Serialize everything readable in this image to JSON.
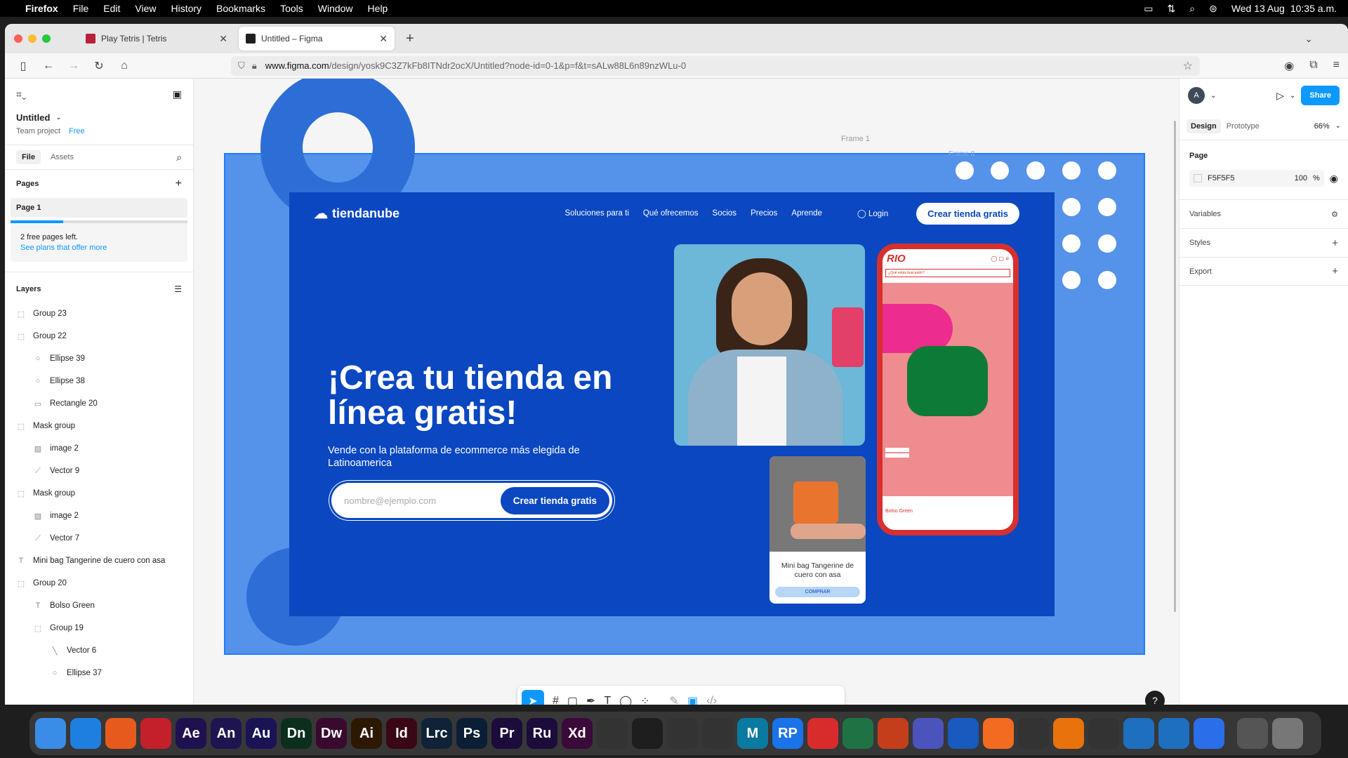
{
  "menubar": {
    "items": [
      "Firefox",
      "File",
      "Edit",
      "View",
      "History",
      "Bookmarks",
      "Tools",
      "Window",
      "Help"
    ],
    "date": "Wed 13 Aug",
    "time": "10:35 a.m."
  },
  "browser": {
    "tabs": [
      {
        "title": "Play Tetris | Tetris",
        "fav_color": "#b9203a"
      },
      {
        "title": "Untitled – Figma",
        "fav_color": "#1e1e1e"
      }
    ],
    "url_host": "www.figma.com",
    "url_path": "/design/yosk9C3Z7kFb8ITNdr2ocX/Untitled?node-id=0-1&p=f&t=sALw88L6n89nzWLu-0"
  },
  "left_panel": {
    "file_name": "Untitled",
    "project": "Team project",
    "plan": "Free",
    "tabs": [
      "File",
      "Assets"
    ],
    "pages_heading": "Pages",
    "page": "Page 1",
    "notice": "2 free pages left.",
    "notice_link": "See plans that offer more",
    "layers_heading": "Layers",
    "layers": [
      {
        "name": "Group 23",
        "indent": 0,
        "icon": "group"
      },
      {
        "name": "Group 22",
        "indent": 0,
        "icon": "group"
      },
      {
        "name": "Ellipse 39",
        "indent": 1,
        "icon": "ellipse"
      },
      {
        "name": "Ellipse 38",
        "indent": 1,
        "icon": "ellipse"
      },
      {
        "name": "Rectangle 20",
        "indent": 1,
        "icon": "rect"
      },
      {
        "name": "Mask group",
        "indent": 0,
        "icon": "group"
      },
      {
        "name": "image 2",
        "indent": 1,
        "icon": "image"
      },
      {
        "name": "Vector 9",
        "indent": 1,
        "icon": "vector"
      },
      {
        "name": "Mask group",
        "indent": 0,
        "icon": "group"
      },
      {
        "name": "image 2",
        "indent": 1,
        "icon": "image"
      },
      {
        "name": "Vector 7",
        "indent": 1,
        "icon": "vector"
      },
      {
        "name": "Mini bag Tangerine de cuero con asa",
        "indent": 0,
        "icon": "text"
      },
      {
        "name": "Group 20",
        "indent": 0,
        "icon": "group"
      },
      {
        "name": "Bolso Green",
        "indent": 1,
        "icon": "text"
      },
      {
        "name": "Group 19",
        "indent": 1,
        "icon": "group"
      },
      {
        "name": "Vector 6",
        "indent": 2,
        "icon": "line"
      },
      {
        "name": "Ellipse 37",
        "indent": 2,
        "icon": "ellipse"
      }
    ]
  },
  "canvas": {
    "frame_label": "Frame 1",
    "frame_label_2": "Frame 8",
    "site": {
      "logo": "tiendanube",
      "nav": [
        "Soluciones para ti",
        "Qué ofrecemos",
        "Socios",
        "Precios",
        "Aprende"
      ],
      "login": "Login",
      "cta": "Crear tienda gratis",
      "headline": "¡Crea tu tienda en línea gratis!",
      "subheadline": "Vende con la plataforma de ecommerce más elegida de Latinoamerica",
      "email_placeholder": "nombre@ejemplo.com",
      "form_button": "Crear tienda gratis",
      "phone_brand": "RIO",
      "phone_search": "¿Qué estás buscando?",
      "phone_product": "Bolso Green",
      "card_title": "Mini bag Tangerine de cuero con asa",
      "card_button": "COMPRAR"
    }
  },
  "right_panel": {
    "avatar": "A",
    "share": "Share",
    "tabs": [
      "Design",
      "Prototype"
    ],
    "zoom": "66%",
    "page_heading": "Page",
    "page_color": "F5F5F5",
    "page_opacity": "100",
    "percent": "%",
    "sections": [
      "Variables",
      "Styles",
      "Export"
    ]
  },
  "dock": {
    "apps": [
      {
        "label": "",
        "color": "#3a8de6"
      },
      {
        "label": "",
        "color": "#1e7fe0"
      },
      {
        "label": "",
        "color": "#e65b1d"
      },
      {
        "label": "",
        "color": "#c4202a"
      },
      {
        "label": "Ae",
        "color": "#1f1150"
      },
      {
        "label": "An",
        "color": "#1e1550"
      },
      {
        "label": "Au",
        "color": "#1a1455"
      },
      {
        "label": "Dn",
        "color": "#0c2f1d"
      },
      {
        "label": "Dw",
        "color": "#3a0a2e"
      },
      {
        "label": "Ai",
        "color": "#2d1804"
      },
      {
        "label": "Id",
        "color": "#3a0716"
      },
      {
        "label": "Lrc",
        "color": "#0f2238"
      },
      {
        "label": "Ps",
        "color": "#0a1e36"
      },
      {
        "label": "Pr",
        "color": "#1b0c3c"
      },
      {
        "label": "Ru",
        "color": "#1b0c3c"
      },
      {
        "label": "Xd",
        "color": "#3a0a3a"
      },
      {
        "label": "",
        "color": "#333"
      },
      {
        "label": "",
        "color": "#1e1e1e"
      },
      {
        "label": "",
        "color": "#333"
      },
      {
        "label": "",
        "color": "#333"
      },
      {
        "label": "M",
        "color": "#0a7aa0"
      },
      {
        "label": "RP",
        "color": "#1a73e8"
      },
      {
        "label": "",
        "color": "#d82c2c"
      },
      {
        "label": "",
        "color": "#1f7244"
      },
      {
        "label": "",
        "color": "#c43e1c"
      },
      {
        "label": "",
        "color": "#4b53bc"
      },
      {
        "label": "",
        "color": "#185abd"
      },
      {
        "label": "",
        "color": "#f36b21"
      },
      {
        "label": "",
        "color": "#333"
      },
      {
        "label": "",
        "color": "#e8730c"
      },
      {
        "label": "",
        "color": "#333"
      },
      {
        "label": "",
        "color": "#1e6fbf"
      },
      {
        "label": "",
        "color": "#1e6fbf"
      },
      {
        "label": "",
        "color": "#2b6ee9"
      },
      {
        "label": "",
        "color": "#555"
      },
      {
        "label": "",
        "color": "#777"
      }
    ]
  }
}
